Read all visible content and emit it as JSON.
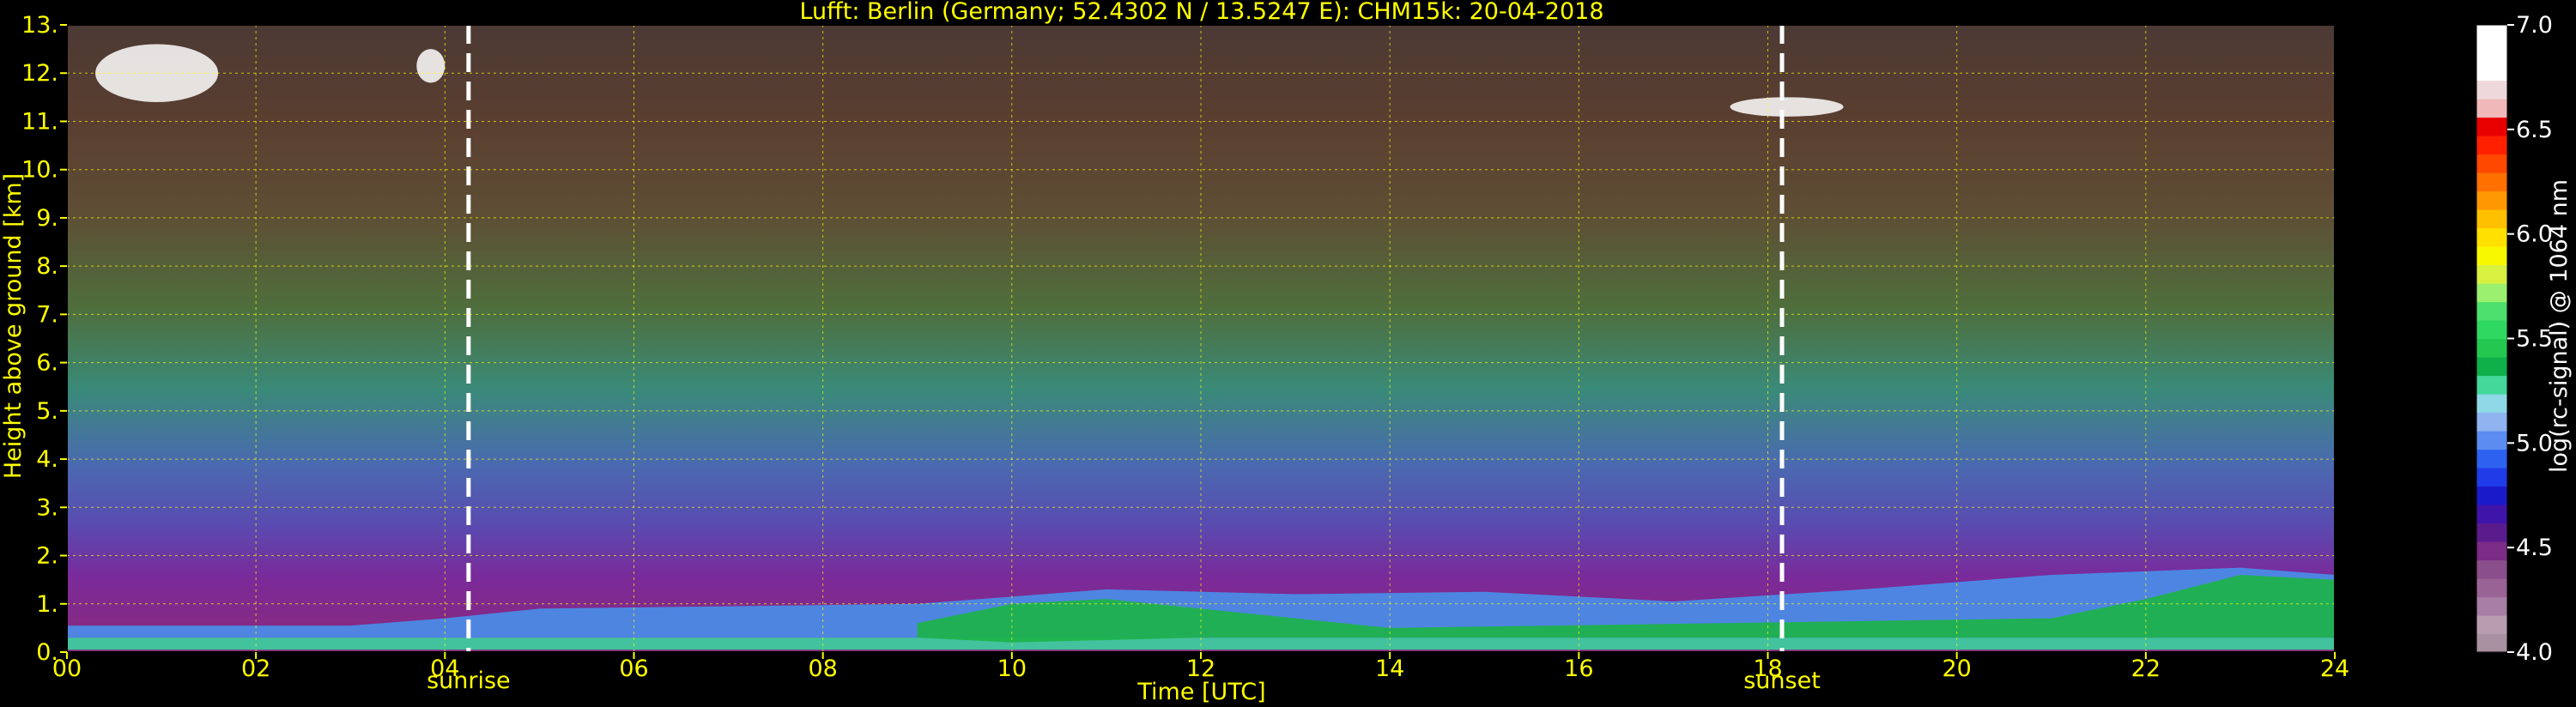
{
  "chart_data": {
    "type": "heatmap",
    "title": "Lufft: Berlin (Germany; 52.4302 N / 13.5247 E):    CHM15k: 20-04-2018",
    "xlabel": "Time [UTC]",
    "ylabel": "Height above ground [km]",
    "colorbar_label": "log(rc-signal) @ 1064 nm",
    "xlim": [
      0,
      24
    ],
    "ylim": [
      0,
      13
    ],
    "x_ticks": [
      0,
      2,
      4,
      6,
      8,
      10,
      12,
      14,
      16,
      18,
      20,
      22,
      24
    ],
    "x_tick_labels": [
      "00",
      "02",
      "04",
      "06",
      "08",
      "10",
      "12",
      "14",
      "16",
      "18",
      "20",
      "22",
      "24"
    ],
    "y_ticks": [
      0,
      1,
      2,
      3,
      4,
      5,
      6,
      7,
      8,
      9,
      10,
      11,
      12,
      13
    ],
    "y_tick_labels": [
      "0.",
      "1.",
      "2.",
      "3.",
      "4.",
      "5.",
      "6.",
      "7.",
      "8.",
      "9.",
      "10.",
      "11.",
      "12.",
      "13."
    ],
    "grid": true,
    "colorbar": {
      "range": [
        4.0,
        7.0
      ],
      "ticks": [
        4.0,
        4.5,
        5.0,
        5.5,
        6.0,
        6.5,
        7.0
      ],
      "tick_labels": [
        "4.0",
        "4.5",
        "5.0",
        "5.5",
        "6.0",
        "6.5",
        "7.0"
      ],
      "colors": [
        "#a991a2",
        "#b89cb0",
        "#a87ea5",
        "#9a6396",
        "#8b4e8c",
        "#7b2c86",
        "#5a1c8c",
        "#3f14a8",
        "#1b1ac8",
        "#1f3ce8",
        "#2d62f0",
        "#5c8cf0",
        "#8fb4f0",
        "#8fd8e8",
        "#44d89a",
        "#0fb04a",
        "#23c850",
        "#2fd860",
        "#4ee06c",
        "#9bf070",
        "#d8f040",
        "#f8f800",
        "#ffe000",
        "#ffc000",
        "#ff9800",
        "#ff7000",
        "#ff4800",
        "#ff2000",
        "#e80000",
        "#f0b8b8",
        "#eed8dc",
        "#ffffff",
        "#ffffff",
        "#ffffff"
      ]
    },
    "annotations": [
      {
        "text": "sunrise",
        "x": 4.25
      },
      {
        "text": "sunset",
        "x": 18.15
      }
    ],
    "layers": [
      {
        "name": "",
        "x": [
          0,
          24
        ],
        "y_bottom": [
          0.05,
          0.05
        ],
        "y_top": [
          0.3,
          0.3
        ],
        "color": "#3cd0a0"
      },
      {
        "name": "",
        "x": [
          0,
          3,
          4,
          5,
          7,
          9,
          11,
          13,
          15,
          17,
          19,
          21,
          23,
          24
        ],
        "y_bottom": [
          0.3,
          0.3,
          0.3,
          0.3,
          0.3,
          0.3,
          0.3,
          0.3,
          0.3,
          0.3,
          0.3,
          0.3,
          0.3,
          0.3
        ],
        "y_top": [
          0.55,
          0.55,
          0.7,
          0.9,
          0.95,
          1.0,
          1.3,
          1.2,
          1.25,
          1.05,
          1.3,
          1.6,
          1.75,
          1.6
        ],
        "color": "#4a8de8"
      },
      {
        "name": "",
        "x": [
          9,
          10,
          11,
          12,
          13,
          14,
          21,
          22,
          23,
          24
        ],
        "y_bottom": [
          0.3,
          0.2,
          0.25,
          0.3,
          0.3,
          0.3,
          0.3,
          0.3,
          0.3,
          0.3
        ],
        "y_top": [
          0.6,
          1.0,
          1.1,
          0.9,
          0.7,
          0.5,
          0.7,
          1.1,
          1.6,
          1.5
        ],
        "color": "#1db34a"
      }
    ],
    "cloud_patches": [
      {
        "x": [
          0.3,
          1.6
        ],
        "y": [
          11.4,
          12.6
        ]
      },
      {
        "x": [
          3.7,
          4.0
        ],
        "y": [
          11.8,
          12.5
        ]
      },
      {
        "x": [
          17.6,
          18.8
        ],
        "y": [
          11.1,
          11.5
        ]
      }
    ]
  }
}
